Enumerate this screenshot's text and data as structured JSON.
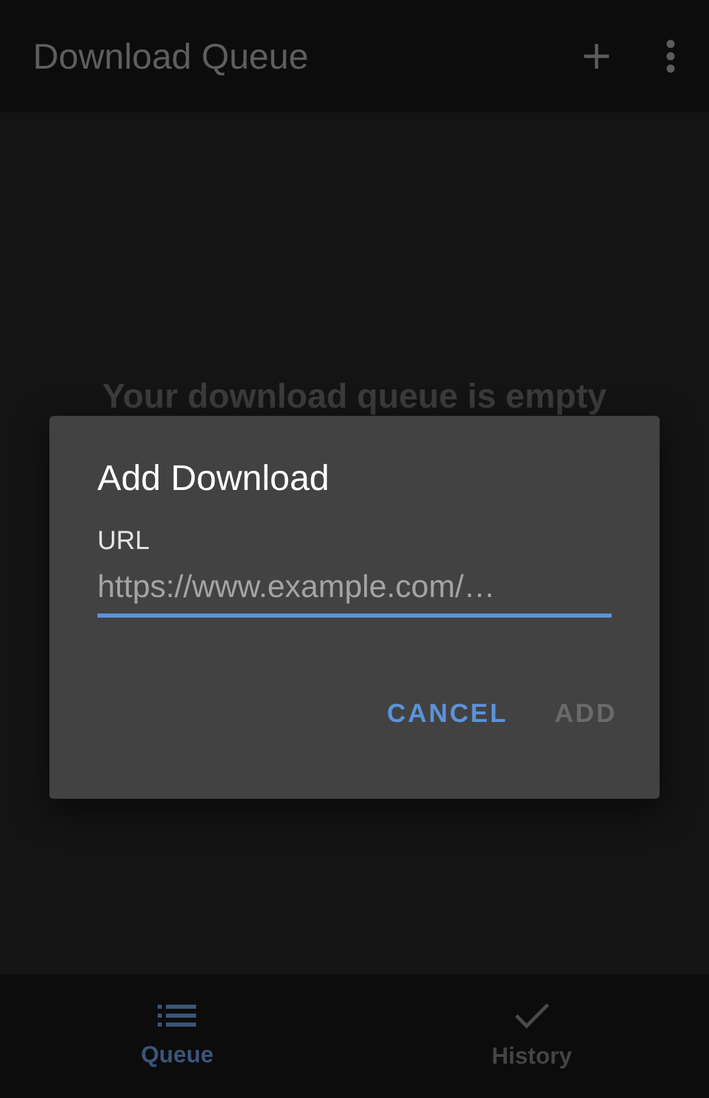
{
  "app_bar": {
    "title": "Download Queue",
    "actions": [
      {
        "kind": "add"
      },
      {
        "kind": "more"
      }
    ]
  },
  "empty_message": "Your download queue is empty",
  "dialog": {
    "title": "Add Download",
    "field": {
      "label": "URL",
      "placeholder": "https://www.example.com/…",
      "focused": true
    },
    "buttons": [
      {
        "label": "CANCEL",
        "disabled": false
      },
      {
        "label": "ADD",
        "disabled": true
      }
    ]
  },
  "bottom_nav": [
    {
      "label": "Queue",
      "kind": "list",
      "selected": true
    },
    {
      "label": "History",
      "kind": "check",
      "selected": false
    }
  ]
}
